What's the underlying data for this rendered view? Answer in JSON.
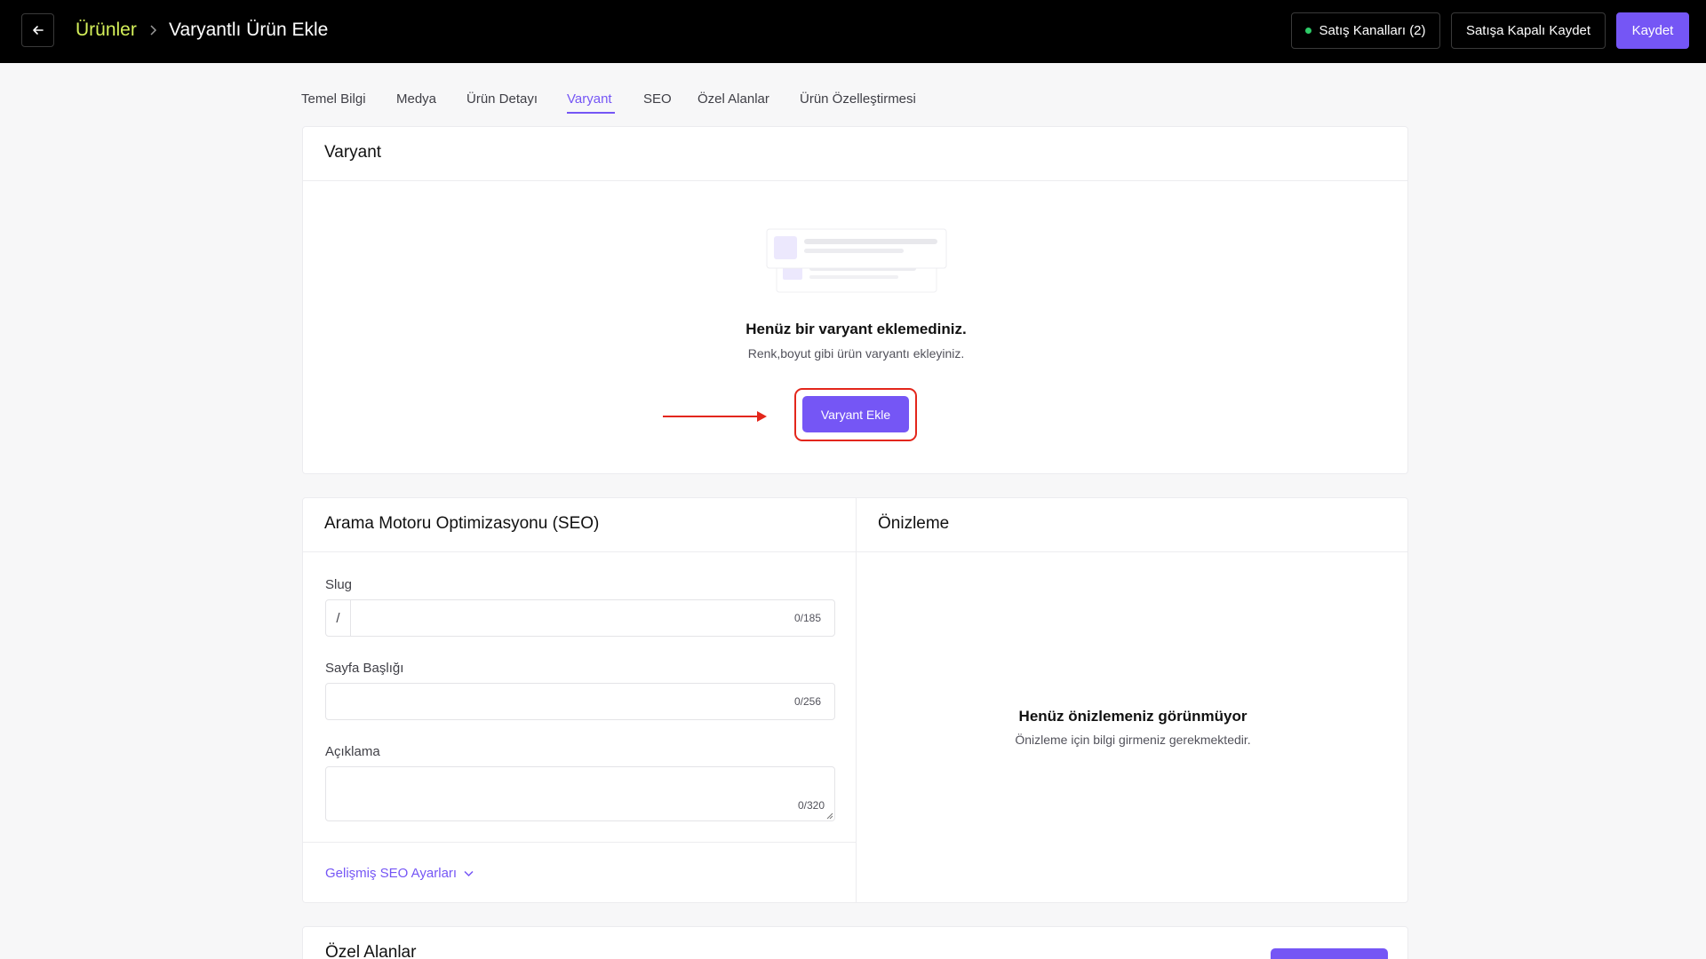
{
  "header": {
    "breadcrumb_parent": "Ürünler",
    "breadcrumb_current": "Varyantlı Ürün Ekle",
    "sales_channels_label": "Satış Kanalları (2)",
    "save_closed_label": "Satışa Kapalı Kaydet",
    "save_label": "Kaydet",
    "accent_color": "#7556f5",
    "breadcrumb_color": "#d5f05a",
    "status_dot_color": "#2ecb68"
  },
  "tabs": [
    {
      "label": "Temel Bilgi"
    },
    {
      "label": "Medya"
    },
    {
      "label": "Ürün Detayı"
    },
    {
      "label": "Varyant",
      "active": true
    },
    {
      "label": "SEO"
    },
    {
      "label": "Özel Alanlar"
    },
    {
      "label": "Ürün Özelleştirmesi"
    }
  ],
  "variant": {
    "title": "Varyant",
    "empty_title": "Henüz bir varyant eklemediniz.",
    "empty_subtitle": "Renk,boyut gibi ürün varyantı ekleyiniz.",
    "add_button": "Varyant Ekle",
    "annotation_color": "#e3261b"
  },
  "seo": {
    "title": "Arama Motoru Optimizasyonu (SEO)",
    "slug_label": "Slug",
    "slug_prefix": "/",
    "slug_value": "",
    "slug_count": "0/185",
    "page_title_label": "Sayfa Başlığı",
    "page_title_value": "",
    "page_title_count": "0/256",
    "description_label": "Açıklama",
    "description_value": "",
    "description_count": "0/320",
    "advanced_link": "Gelişmiş SEO Ayarları"
  },
  "preview": {
    "title": "Önizleme",
    "empty_title": "Henüz önizlemeniz görünmüyor",
    "empty_subtitle": "Önizleme için bilgi girmeniz gerekmektedir."
  },
  "custom_fields": {
    "title": "Özel Alanlar"
  }
}
